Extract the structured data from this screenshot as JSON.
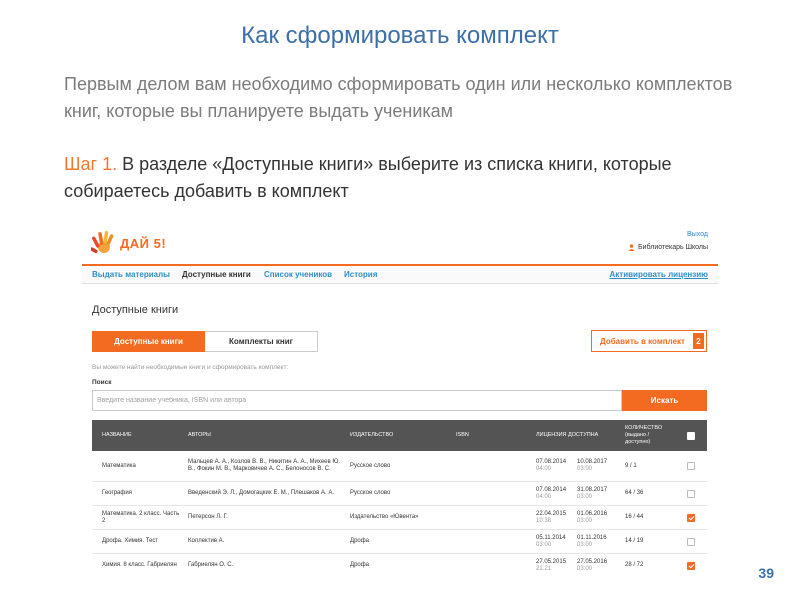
{
  "slide": {
    "title": "Как сформировать комплект",
    "intro": "Первым делом вам необходимо сформировать один или несколько комплектов книг, которые вы планируете выдать ученикам",
    "step_prefix": "Шаг 1.",
    "step_text": " В разделе «Доступные книги» выберите из списка книги, которые собираетесь добавить в комплект",
    "page_number": "39"
  },
  "app": {
    "logo_text": "ДАЙ 5!",
    "logout": "Выход",
    "user": "Библиотекарь Школы",
    "nav": {
      "items": [
        "Выдать материалы",
        "Доступные книги",
        "Список учеников",
        "История"
      ],
      "license": "Активировать лицензию"
    },
    "page_heading": "Доступные книги",
    "tabs": [
      "Доступные книги",
      "Комплекты книг"
    ],
    "add_button": {
      "label": "Добавить в комплект",
      "count": "2"
    },
    "hint": "Вы можете найти необходимые книги и сформировать комплект:",
    "search": {
      "label": "Поиск",
      "placeholder": "Введите название учебника, ISBN или автора",
      "button": "Искать"
    },
    "table": {
      "headers": {
        "name": "Название",
        "authors": "Авторы",
        "publisher": "Издательство",
        "isbn": "ISBN",
        "license": "Лицензия доступна",
        "qty_line1": "Количество",
        "qty_line2": "(выдано /",
        "qty_line3": "доступно)"
      },
      "rows": [
        {
          "name": "Математика",
          "authors": "Мальцев А. А., Козлов В. В., Никитин А. А., Михеев Ю. В., Фокин М. В., Марковичев А. С., Белоносов В. С.",
          "publisher": "Русское слово",
          "isbn": "",
          "date_from": "07.08.2014",
          "time_from": "04:00",
          "date_to": "10.08.2017",
          "time_to": "03:00",
          "qty": "9 / 1",
          "checked": false
        },
        {
          "name": "География",
          "authors": "Введенский Э. Л., Домогацких Е. М., Плешаков А. А.",
          "publisher": "Русское слово",
          "isbn": "",
          "date_from": "07.08.2014",
          "time_from": "04:00",
          "date_to": "31.08.2017",
          "time_to": "03:00",
          "qty": "64 / 36",
          "checked": false
        },
        {
          "name": "Математика. 2 класс. Часть 2",
          "authors": "Петерсон Л. Г.",
          "publisher": "Издательство «Ювента»",
          "isbn": "",
          "date_from": "22.04.2015",
          "time_from": "10:38",
          "date_to": "01.06.2016",
          "time_to": "03:00",
          "qty": "16 / 44",
          "checked": true
        },
        {
          "name": "Дрофа. Химия. Тест",
          "authors": "Коллектив А.",
          "publisher": "Дрофа",
          "isbn": "",
          "date_from": "05.11.2014",
          "time_from": "03:00",
          "date_to": "01.11.2016",
          "time_to": "03:00",
          "qty": "14 / 19",
          "checked": false
        },
        {
          "name": "Химия. 8 класс. Габриелян",
          "authors": "Габриелян О. С.",
          "publisher": "Дрофа",
          "isbn": "",
          "date_from": "27.05.2015",
          "time_from": "21:21",
          "date_to": "27.05.2016",
          "time_to": "03:00",
          "qty": "28 / 72",
          "checked": true
        }
      ]
    }
  },
  "colors": {
    "accent": "#f26b21",
    "title_blue": "#3d6fa8",
    "link": "#2e8fc7",
    "header_bg": "#545454"
  }
}
